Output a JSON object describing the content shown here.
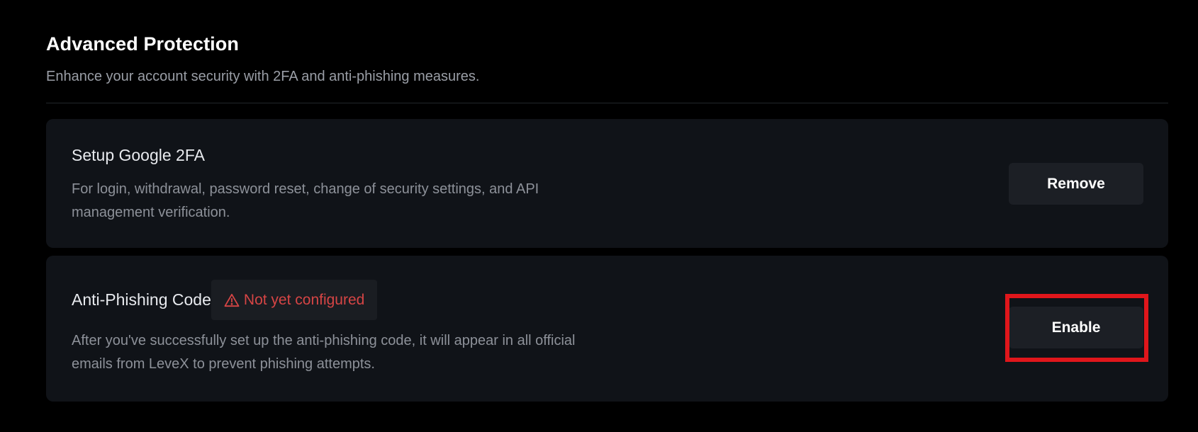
{
  "section": {
    "title": "Advanced Protection",
    "subtitle": "Enhance your account security with 2FA and anti-phishing measures."
  },
  "cards": {
    "google_2fa": {
      "title": "Setup Google 2FA",
      "description": "For login, withdrawal, password reset, change of security settings, and API management verification.",
      "button_label": "Remove"
    },
    "anti_phishing": {
      "title": "Anti-Phishing Code",
      "status_label": "Not yet configured",
      "status_icon": "warning-triangle-icon",
      "status_color": "#d64545",
      "description": "After you've successfully set up the anti-phishing code, it will appear in all official emails from LeveX to prevent phishing attempts.",
      "button_label": "Enable"
    }
  },
  "colors": {
    "background": "#000000",
    "card_background": "#101318",
    "button_background": "#1c1f25",
    "highlight": "#e0161b"
  }
}
